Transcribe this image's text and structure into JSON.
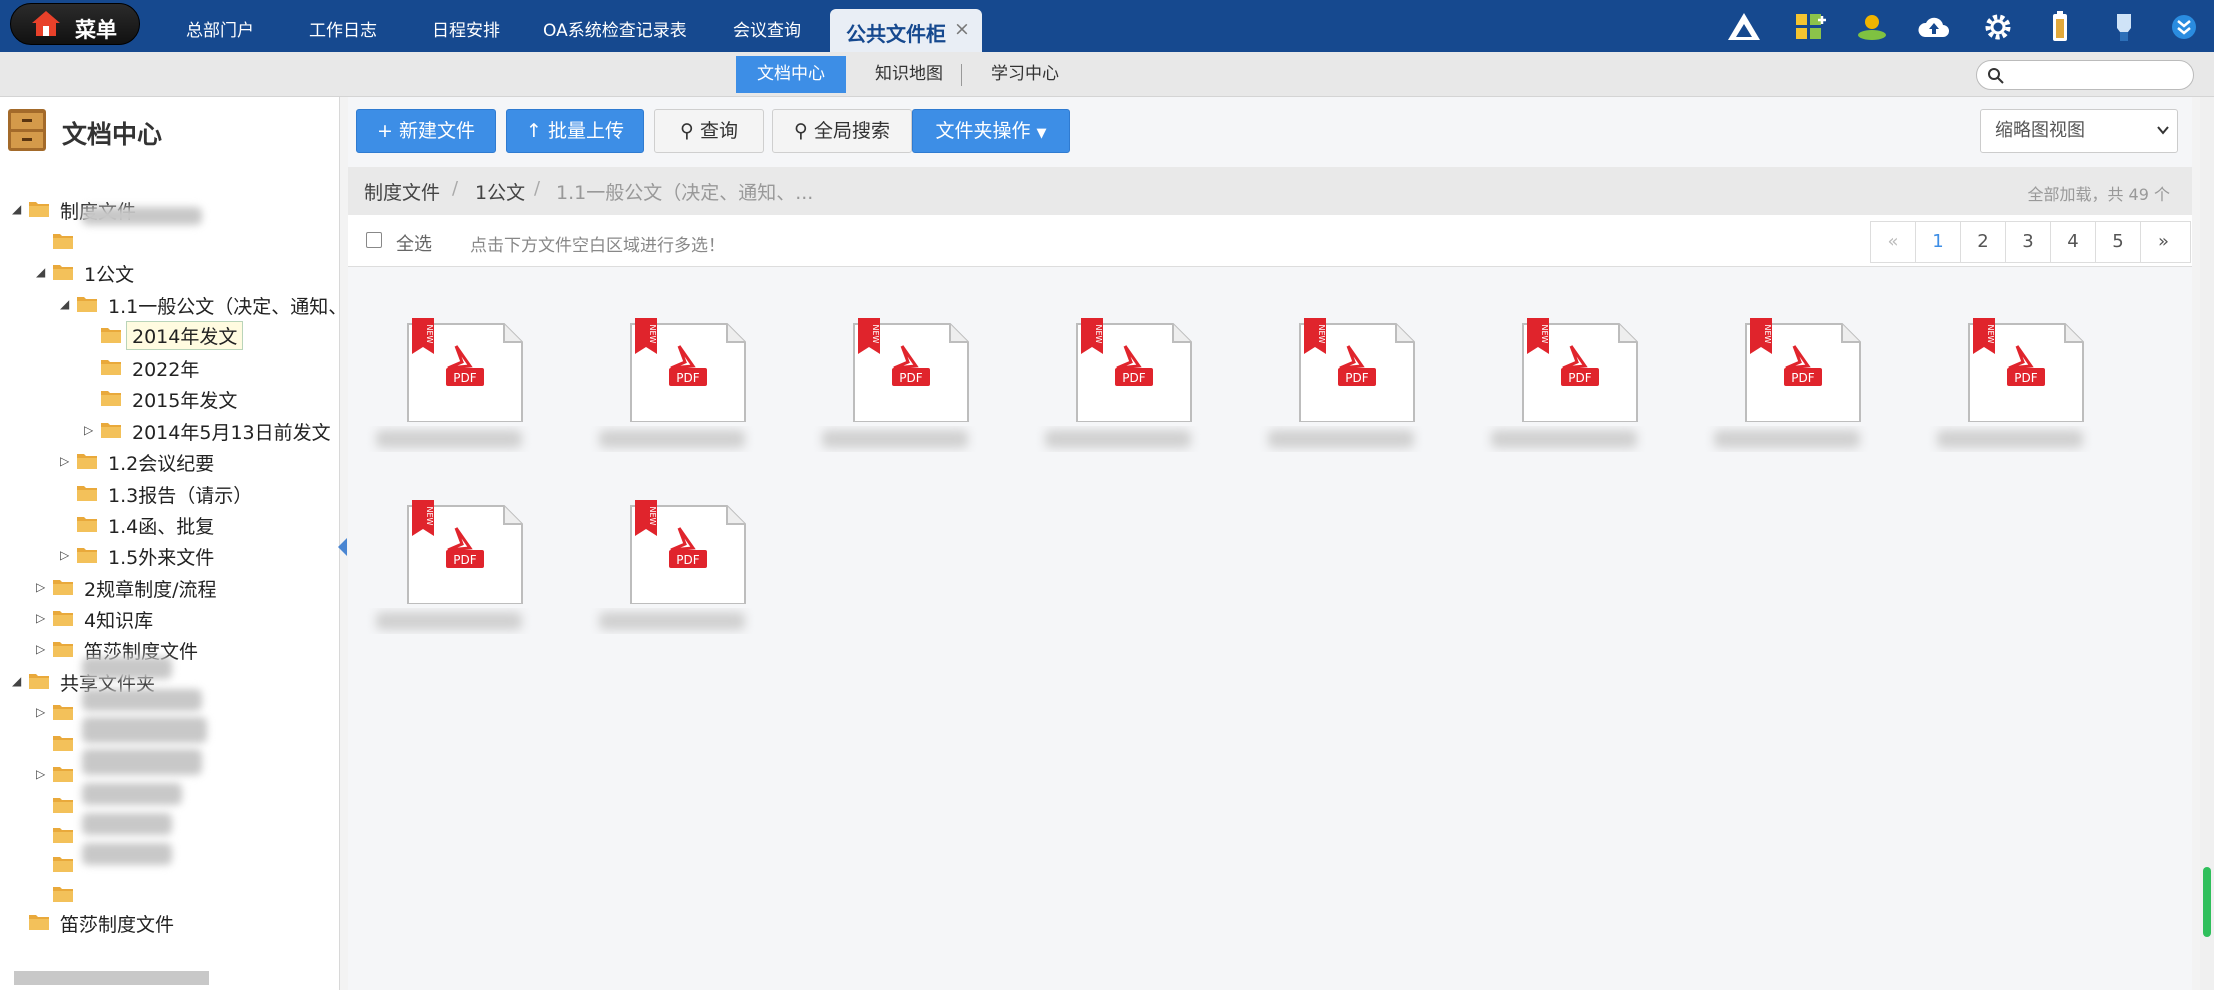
{
  "topbar": {
    "menu_label": "菜单",
    "tabs": [
      {
        "label": "总部门户"
      },
      {
        "label": "工作日志"
      },
      {
        "label": "日程安排"
      },
      {
        "label": "OA系统检查记录表"
      },
      {
        "label": "会议查询"
      }
    ],
    "active_tab": {
      "label": "公共文件柜",
      "close": "×"
    },
    "icons": [
      "up-triangle-icon",
      "apps-plus-icon",
      "user-status-icon",
      "cloud-upload-icon",
      "gear-icon",
      "battery-icon",
      "bulb-icon",
      "chevron-down-circle-icon"
    ]
  },
  "subnav": {
    "tabs": [
      {
        "label": "文档中心",
        "active": true
      },
      {
        "label": "知识地图",
        "active": false
      },
      {
        "label": "学习中心",
        "active": false
      }
    ],
    "search_placeholder": ""
  },
  "left_panel": {
    "title": "文档中心",
    "tree": [
      {
        "label": "制度文件",
        "toggle": "◢"
      },
      {
        "label": "",
        "toggle": ""
      },
      {
        "label": "1公文",
        "toggle": "◢"
      },
      {
        "label": "1.1一般公文（决定、通知、",
        "toggle": "◢"
      },
      {
        "label": "2014年发文",
        "toggle": "",
        "selected": true
      },
      {
        "label": "2022年",
        "toggle": ""
      },
      {
        "label": "2015年发文",
        "toggle": ""
      },
      {
        "label": "2014年5月13日前发文",
        "toggle": "▷"
      },
      {
        "label": "1.2会议纪要",
        "toggle": "▷"
      },
      {
        "label": "1.3报告（请示）",
        "toggle": ""
      },
      {
        "label": "1.4函、批复",
        "toggle": ""
      },
      {
        "label": "1.5外来文件",
        "toggle": "▷"
      },
      {
        "label": "2规章制度/流程",
        "toggle": "▷"
      },
      {
        "label": "4知识库",
        "toggle": "▷"
      },
      {
        "label": "笛莎制度文件",
        "toggle": "▷"
      },
      {
        "label": "共享文件夹",
        "toggle": "◢"
      },
      {
        "label": "",
        "toggle": "▷"
      },
      {
        "label": "",
        "toggle": ""
      },
      {
        "label": "",
        "toggle": "▷"
      },
      {
        "label": "",
        "toggle": ""
      },
      {
        "label": "",
        "toggle": ""
      },
      {
        "label": "",
        "toggle": ""
      },
      {
        "label": "",
        "toggle": ""
      },
      {
        "label": "笛莎制度文件",
        "toggle": ""
      }
    ]
  },
  "toolbar": {
    "new_file": "新建文件",
    "batch_upload": "批量上传",
    "query": "查询",
    "global_search": "全局搜索",
    "folder_ops": "文件夹操作",
    "view_mode": "缩略图视图"
  },
  "breadcrumb": {
    "items": [
      "制度文件",
      "1公文",
      "1.1一般公文（决定、通知、..."
    ],
    "separator": "/",
    "count_text": "全部加载，共 49 个"
  },
  "selection": {
    "select_all": "全选",
    "hint": "点击下方文件空白区域进行多选！"
  },
  "pager": {
    "prev": "«",
    "pages": [
      "1",
      "2",
      "3",
      "4",
      "5"
    ],
    "next": "»",
    "current": "1"
  },
  "files": [
    {
      "badge": "NEW",
      "type": "PDF"
    },
    {
      "badge": "NEW",
      "type": "PDF"
    },
    {
      "badge": "NEW",
      "type": "PDF"
    },
    {
      "badge": "NEW",
      "type": "PDF"
    },
    {
      "badge": "NEW",
      "type": "PDF"
    },
    {
      "badge": "NEW",
      "type": "PDF"
    },
    {
      "badge": "NEW",
      "type": "PDF"
    },
    {
      "badge": "NEW",
      "type": "PDF"
    },
    {
      "badge": "NEW",
      "type": "PDF"
    },
    {
      "badge": "NEW",
      "type": "PDF"
    }
  ],
  "colors": {
    "topbar": "#16498f",
    "accent": "#3d8ee6",
    "pdf_red": "#e0242c",
    "folder": "#e9a93b"
  }
}
